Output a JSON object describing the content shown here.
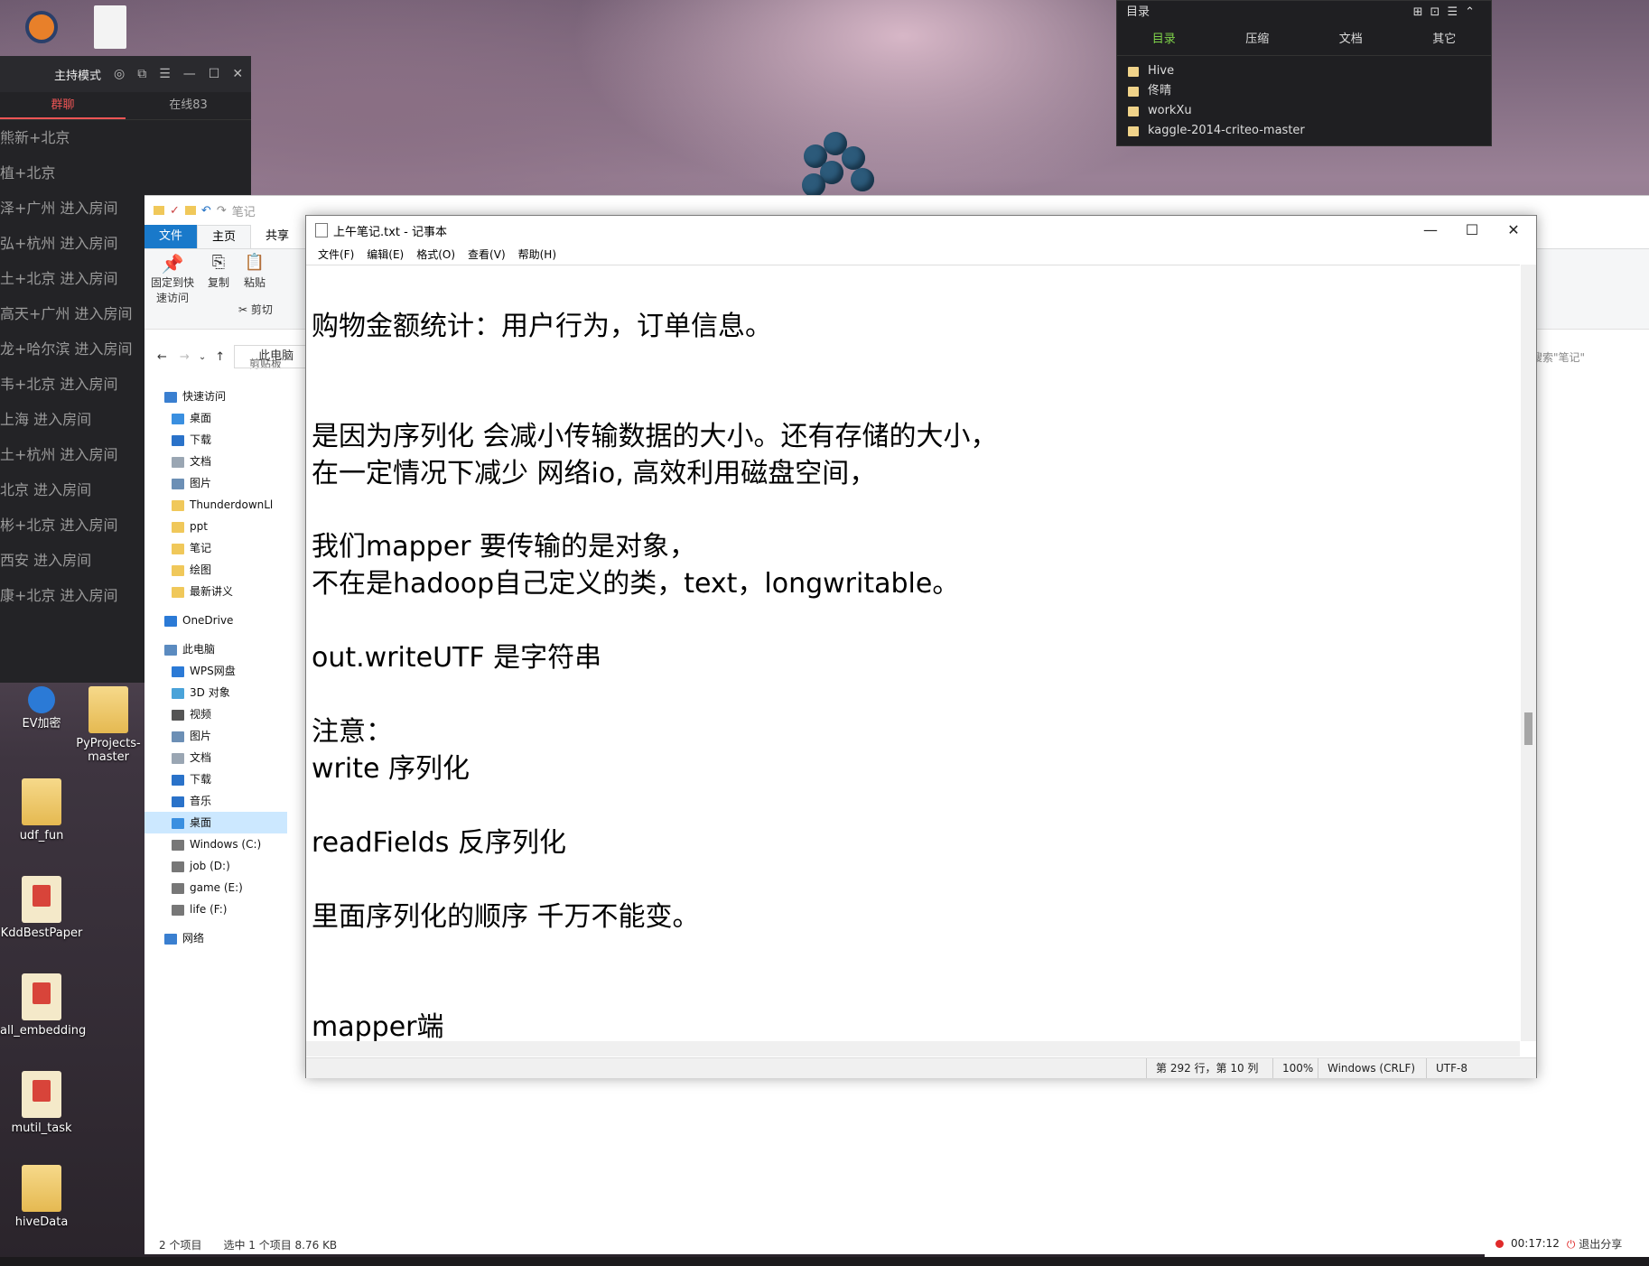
{
  "host": {
    "title": "主持模式",
    "tabs": [
      "群聊",
      "在线83"
    ],
    "entries": [
      "熊新+北京",
      "植+北京",
      "泽+广州 进入房间",
      "弘+杭州 进入房间",
      "土+北京 进入房间",
      "高天+广州 进入房间",
      "龙+哈尔滨 进入房间",
      "韦+北京 进入房间",
      "上海 进入房间",
      "土+杭州 进入房间",
      "北京 进入房间",
      "彬+北京 进入房间",
      "西安 进入房间",
      "康+北京 进入房间"
    ]
  },
  "directory": {
    "title": "目录",
    "tabs": [
      "目录",
      "压缩",
      "文档",
      "其它"
    ],
    "items": [
      "Hive",
      "佟晴",
      "workXu",
      "kaggle-2014-criteo-master"
    ]
  },
  "desktop": {
    "icons": [
      "EV加密",
      "PyProjects-master",
      "udf_fun",
      "KddBestPaper",
      "all_embedding",
      "mutil_task",
      "hiveData"
    ]
  },
  "explorer": {
    "qa_path": "笔记",
    "ribbon_tabs": [
      "文件",
      "主页",
      "共享"
    ],
    "ribbon_buttons": {
      "pin": "固定到快速访问",
      "copy": "复制",
      "paste": "粘贴",
      "cut": "剪切",
      "clipboard_group": "剪贴板"
    },
    "address": "此电脑",
    "search_placeholder": "搜索\"笔记\"",
    "nav": [
      {
        "label": "快速访问",
        "level": 0,
        "icon": "star-icon"
      },
      {
        "label": "桌面",
        "level": 1,
        "icon": "desktop-icon"
      },
      {
        "label": "下载",
        "level": 1,
        "icon": "download-icon"
      },
      {
        "label": "文档",
        "level": 1,
        "icon": "document-icon"
      },
      {
        "label": "图片",
        "level": 1,
        "icon": "picture-icon"
      },
      {
        "label": "ThunderdownLl",
        "level": 1,
        "icon": "folder-icon"
      },
      {
        "label": "ppt",
        "level": 1,
        "icon": "folder-icon"
      },
      {
        "label": "笔记",
        "level": 1,
        "icon": "folder-icon"
      },
      {
        "label": "绘图",
        "level": 1,
        "icon": "folder-icon"
      },
      {
        "label": "最新讲义",
        "level": 1,
        "icon": "folder-icon"
      },
      {
        "label": "OneDrive",
        "level": 0,
        "icon": "cloud-icon"
      },
      {
        "label": "此电脑",
        "level": 0,
        "icon": "computer-icon"
      },
      {
        "label": "WPS网盘",
        "level": 1,
        "icon": "cloud-icon"
      },
      {
        "label": "3D 对象",
        "level": 1,
        "icon": "cube-icon"
      },
      {
        "label": "视频",
        "level": 1,
        "icon": "video-icon"
      },
      {
        "label": "图片",
        "level": 1,
        "icon": "picture-icon"
      },
      {
        "label": "文档",
        "level": 1,
        "icon": "document-icon"
      },
      {
        "label": "下载",
        "level": 1,
        "icon": "download-icon"
      },
      {
        "label": "音乐",
        "level": 1,
        "icon": "music-icon"
      },
      {
        "label": "桌面",
        "level": 1,
        "icon": "desktop-icon"
      },
      {
        "label": "Windows (C:)",
        "level": 1,
        "icon": "drive-icon"
      },
      {
        "label": "job (D:)",
        "level": 1,
        "icon": "drive-icon"
      },
      {
        "label": "game (E:)",
        "level": 1,
        "icon": "drive-icon"
      },
      {
        "label": "life (F:)",
        "level": 1,
        "icon": "drive-icon"
      },
      {
        "label": "网络",
        "level": 0,
        "icon": "network-icon"
      }
    ],
    "status": {
      "count": "2 个项目",
      "selected": "选中 1 个项目 8.76 KB"
    }
  },
  "notepad": {
    "title": "上午笔记.txt - 记事本",
    "menu": [
      "文件(F)",
      "编辑(E)",
      "格式(O)",
      "查看(V)",
      "帮助(H)"
    ],
    "lines": [
      "购物金额统计：用户行为，订单信息。",
      "是因为序列化 会减小传输数据的大小。还有存储的大小，",
      "在一定情况下减少 网络io, 高效利用磁盘空间，",
      "我们mapper 要传输的是对象，",
      "不在是hadoop自己定义的类，text，longwritable。",
      "out.writeUTF 是字符串",
      "注意：",
      "write 序列化",
      "readFields 反序列化",
      "里面序列化的顺序 千万不能变。",
      "mapper端"
    ],
    "status": {
      "position": "第 292 行，第 10 列",
      "zoom": "100%",
      "line_ending": "Windows (CRLF)",
      "encoding": "UTF-8"
    }
  },
  "recorder": {
    "time": "00:17:12",
    "exit_label": "退出分享"
  }
}
